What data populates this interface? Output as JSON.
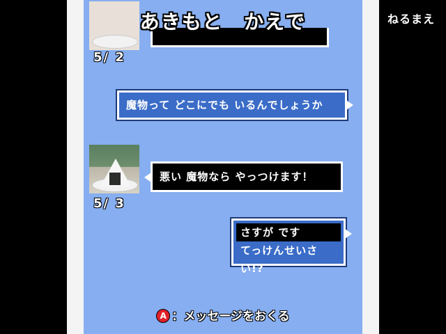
{
  "header": {
    "contact_name": "あきもと　かえで"
  },
  "sidebar": {
    "sleep_label": "ねるまえ"
  },
  "messages": [
    {
      "date": "5/ 2"
    },
    {
      "text": "魔物って どこにでも いるんでしょうか"
    },
    {
      "date": "5/ 3",
      "text": "悪い 魔物なら やっつけます！"
    }
  ],
  "choices": [
    {
      "label": "さすが です",
      "selected": true
    },
    {
      "label": "てっけんせいさい!?",
      "selected": false
    }
  ],
  "footer": {
    "button_icon": "A",
    "hint": "：メッセージをおくる"
  },
  "colors": {
    "screen_bg": "#86aef0",
    "bubble_blue": "#3a6cc8",
    "button_red": "#e0202a"
  }
}
